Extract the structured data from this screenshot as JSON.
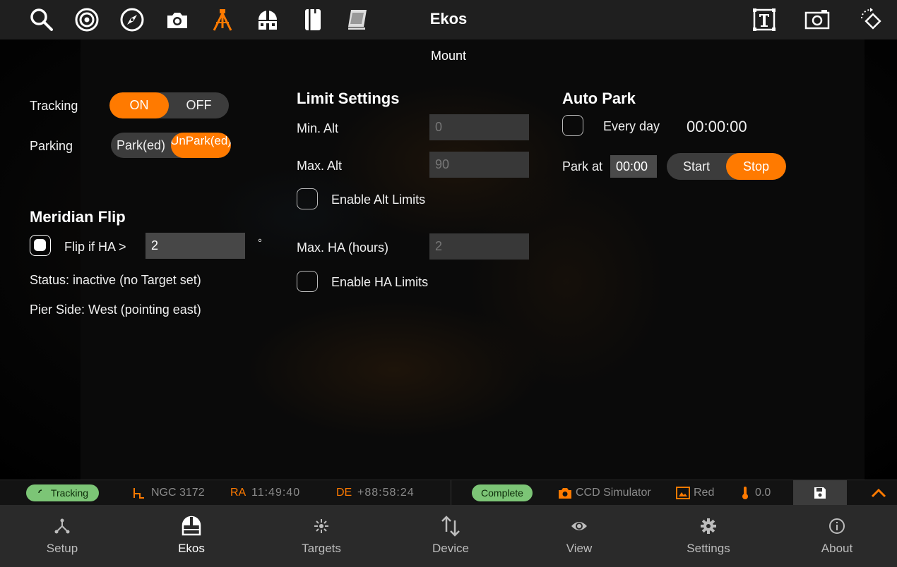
{
  "app": {
    "title": "Ekos"
  },
  "toolbar": {
    "left_icons": [
      "search-icon",
      "target-icon",
      "compass-icon",
      "camera-icon",
      "tripod-icon",
      "observatory-icon",
      "filter-wheel-icon",
      "flat-panel-icon"
    ],
    "right_icons": [
      "text-box-icon",
      "capture-frame-icon",
      "rotate-icon"
    ],
    "active_icon": "tripod-icon",
    "accent": "#ff7a00"
  },
  "page": {
    "subtitle": "Mount"
  },
  "tracking": {
    "label": "Tracking",
    "on": "ON",
    "off": "OFF",
    "selected": "ON"
  },
  "parking": {
    "label": "Parking",
    "park": "Park(ed)",
    "unpark": "UnPark(ed)",
    "selected": "UnPark(ed)"
  },
  "meridian_flip": {
    "heading": "Meridian Flip",
    "checkbox_label": "Flip if HA >",
    "checked": true,
    "ha_value": "2",
    "unit": "°",
    "status": "Status: inactive (no Target set)",
    "pier_side": "Pier Side: West (pointing east)"
  },
  "limit_settings": {
    "heading": "Limit Settings",
    "min_alt_label": "Min. Alt",
    "min_alt_value": "0",
    "max_alt_label": "Max. Alt",
    "max_alt_value": "90",
    "enable_alt_label": "Enable Alt Limits",
    "max_ha_label": "Max. HA (hours)",
    "max_ha_value": "2",
    "enable_ha_label": "Enable HA Limits"
  },
  "auto_park": {
    "heading": "Auto Park",
    "every_day_label": "Every day",
    "time": "00:00:00",
    "park_at_label": "Park at",
    "park_at_value": "00:00",
    "start": "Start",
    "stop": "Stop",
    "selected": "Stop"
  },
  "status_bar": {
    "tracking_badge": "Tracking",
    "target": "NGC 3172",
    "ra_label": "RA",
    "ra_value": "11:49:40",
    "de_label": "DE",
    "de_value": "+88:58:24",
    "complete_badge": "Complete",
    "camera": "CCD Simulator",
    "filter": "Red",
    "temperature": "0.0",
    "badge_color": "#7cc576"
  },
  "bottom_nav": {
    "items": [
      {
        "label": "Setup",
        "icon": "setup-icon"
      },
      {
        "label": "Ekos",
        "icon": "ekos-icon"
      },
      {
        "label": "Targets",
        "icon": "targets-icon"
      },
      {
        "label": "Device",
        "icon": "device-icon"
      },
      {
        "label": "View",
        "icon": "eye-icon"
      },
      {
        "label": "Settings",
        "icon": "gear-icon"
      },
      {
        "label": "About",
        "icon": "info-icon"
      }
    ],
    "active": "Ekos"
  }
}
